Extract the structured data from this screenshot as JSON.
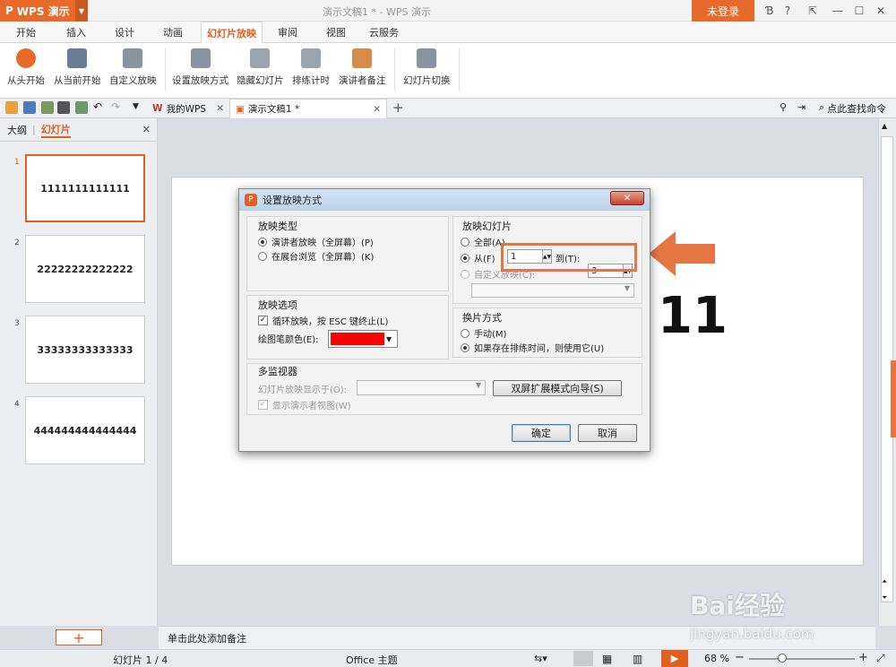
{
  "app": {
    "name": "WPS 演示",
    "title": "演示文稿1 * - WPS 演示",
    "login": "未登录"
  },
  "menu": [
    "开始",
    "插入",
    "设计",
    "动画",
    "幻灯片放映",
    "审阅",
    "视图",
    "云服务"
  ],
  "ribbon": [
    "从头开始",
    "从当前开始",
    "自定义放映",
    "设置放映方式",
    "隐藏幻灯片",
    "排练计时",
    "演讲者备注",
    "幻灯片切换"
  ],
  "tabs": {
    "wps": "我的WPS",
    "doc": "演示文稿1 *",
    "search": "点此查找命令"
  },
  "leftpane": {
    "outline": "大纲",
    "slides": "幻灯片",
    "sep": "|"
  },
  "thumbs": [
    {
      "num": "1",
      "text": "1111111111111"
    },
    {
      "num": "2",
      "text": "22222222222222"
    },
    {
      "num": "3",
      "text": "33333333333333"
    },
    {
      "num": "4",
      "text": "444444444444444"
    }
  ],
  "slide": {
    "big_text": "11"
  },
  "notes": "单击此处添加备注",
  "status": {
    "slide": "幻灯片 1 / 4",
    "theme": "Office 主题",
    "zoom": "68 %",
    "minus": "−",
    "plus": "+"
  },
  "dialog": {
    "title": "设置放映方式",
    "show_type": {
      "title": "放映类型",
      "opt1": "演讲者放映（全屏幕）(P)",
      "opt2": "在展台浏览（全屏幕）(K)"
    },
    "show_slides": {
      "title": "放映幻灯片",
      "all": "全部(A)",
      "from": "从(F)",
      "from_val": "1",
      "to": "到(T):",
      "to_val": "3",
      "custom": "自定义放映(C):"
    },
    "options": {
      "title": "放映选项",
      "loop": "循环放映，按 ESC 键终止(L)",
      "pen": "绘图笔颜色(E):",
      "pen_color": "#ff0000"
    },
    "advance": {
      "title": "换片方式",
      "manual": "手动(M)",
      "timing": "如果存在排练时间，则使用它(U)"
    },
    "monitors": {
      "title": "多监视器",
      "display_on": "幻灯片放映显示于(O):",
      "wizard": "双屏扩展模式向导(S)",
      "presenter": "显示演示者视图(W)"
    },
    "ok": "确定",
    "cancel": "取消"
  },
  "watermark": {
    "logo": "Bai经验",
    "url": "jingyan.baidu.com"
  }
}
